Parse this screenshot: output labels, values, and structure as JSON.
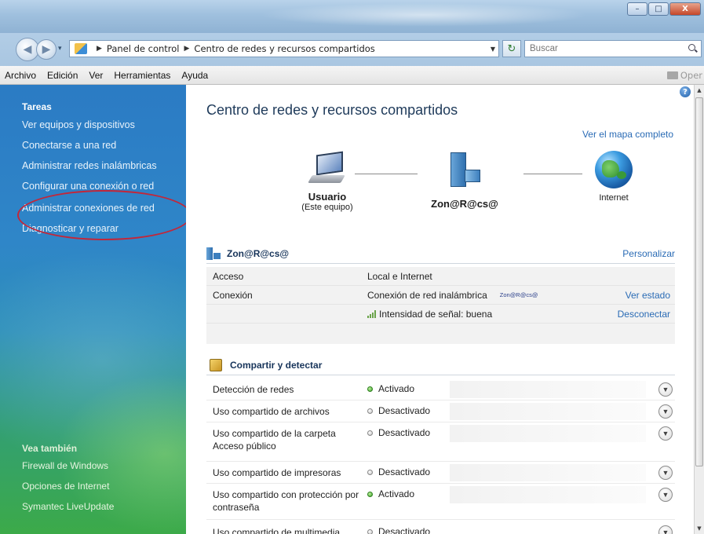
{
  "window": {
    "minimize_label": "–",
    "maximize_label": "□",
    "close_label": "X"
  },
  "address": {
    "crumbs": [
      "Panel de control",
      "Centro de redes y recursos compartidos"
    ],
    "search_placeholder": "Buscar"
  },
  "menu": {
    "items": [
      "Archivo",
      "Edición",
      "Ver",
      "Herramientas",
      "Ayuda"
    ],
    "right_label": "Oper"
  },
  "sidebar": {
    "tasks_title": "Tareas",
    "tasks": [
      "Ver equipos y dispositivos",
      "Conectarse a una red",
      "Administrar redes inalámbricas",
      "Configurar una conexión o red",
      "Administrar conexiones de red",
      "Diagnosticar y reparar"
    ],
    "see_also_title": "Vea también",
    "see_also": [
      "Firewall de Windows",
      "Opciones de Internet",
      "Symantec LiveUpdate"
    ]
  },
  "main": {
    "title": "Centro de redes y recursos compartidos",
    "view_map": "Ver el mapa completo",
    "nodes": {
      "user_name": "Usuario",
      "user_sub": "(Este equipo)",
      "network_name": "Zon@R@cs@",
      "internet_name": "Internet"
    },
    "network_section": {
      "title": "Zon@R@cs@",
      "action": "Personalizar",
      "access_label": "Acceso",
      "access_value": "Local e Internet",
      "connection_label": "Conexión",
      "connection_value": "Conexión de red inalámbrica",
      "connection_tiny": "Zon@R@cs@",
      "connection_link": "Ver estado",
      "signal_value": "Intensidad de señal: buena",
      "signal_link": "Desconectar"
    },
    "share_section": {
      "title": "Compartir y detectar",
      "rows": [
        {
          "label": "Detección de redes",
          "status": "Activado"
        },
        {
          "label": "Uso compartido de archivos",
          "status": "Desactivado"
        },
        {
          "label": "Uso compartido de la carpeta Acceso público",
          "status": "Desactivado"
        },
        {
          "label": "Uso compartido de impresoras",
          "status": "Desactivado"
        },
        {
          "label": "Uso compartido con protección por contraseña",
          "status": "Activado"
        },
        {
          "label": "Uso compartido de multimedia",
          "status": "Desactivado"
        }
      ]
    }
  }
}
